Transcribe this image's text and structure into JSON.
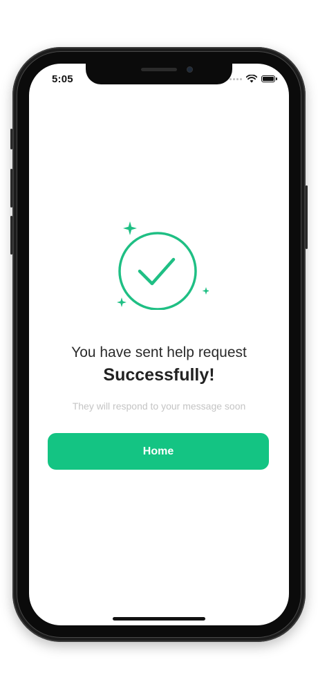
{
  "status_bar": {
    "time": "5:05"
  },
  "success": {
    "heading": "You have sent help request",
    "emphasis": "Successfully!",
    "subtitle": "They will respond to your message soon"
  },
  "actions": {
    "home_label": "Home"
  },
  "colors": {
    "accent": "#14c483",
    "check_green": "#1fbf84",
    "subtitle_gray": "#c4c4c4"
  },
  "icons": {
    "success": "check-circle-icon",
    "sparkle": "sparkle-icon",
    "wifi": "wifi-icon",
    "battery": "battery-icon"
  }
}
